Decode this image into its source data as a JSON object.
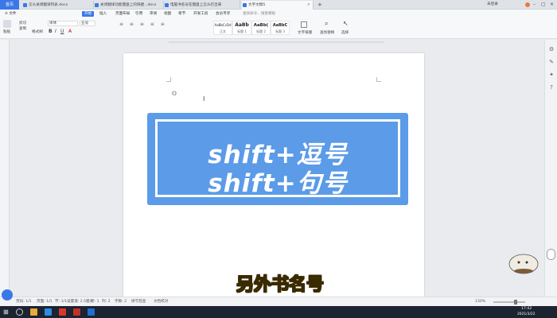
{
  "tabbar": {
    "home": "首页",
    "tabs": [
      {
        "label": "怎么关闭翻译列表.docx"
      },
      {
        "label": "关闭翻译功能键盘上的快捷...docx"
      },
      {
        "label": "电脑书名号在键盘上怎么打出来"
      },
      {
        "label": "文字文稿5"
      }
    ],
    "add": "+",
    "right": {
      "login": "未登录",
      "collab": "协作",
      "share": "分享"
    }
  },
  "menu": {
    "file": "≡ 文件",
    "items": [
      "开始",
      "插入",
      "页面布局",
      "引用",
      "审阅",
      "视图",
      "章节",
      "开发工具",
      "会员专享"
    ],
    "search": "查找命令、搜索模板"
  },
  "ribbon": {
    "paste": "粘贴",
    "cut": "剪切",
    "copy": "复制",
    "format_painter": "格式刷",
    "font": "宋体",
    "font_size": "五号",
    "styles": [
      {
        "preview": "AaBbCcDd",
        "name": "正文"
      },
      {
        "preview": "AaBb",
        "name": "标题 1"
      },
      {
        "preview": "AaBb(",
        "name": "标题 2"
      },
      {
        "preview": "AaBbC",
        "name": "标题 3"
      }
    ],
    "text_layout": "文字排版",
    "find_replace": "查找替换",
    "select": "选择"
  },
  "document": {
    "banner_line1": "shift+逗号",
    "banner_line2": "shift+句号",
    "cursor_text": "《》"
  },
  "subtitle": "另外书名号",
  "status": {
    "page": "页码: 1/1",
    "pages": "页面: 1/1",
    "section": "节: 1/1",
    "settings": "设置值: 2.5厘米",
    "row": "行: 1",
    "col": "列: 2",
    "words": "字数: 2",
    "spell": "拼写检查",
    "doc_check": "文档校对",
    "zoom": "130%"
  },
  "taskbar": {
    "time": "17:42",
    "date": "2021/3/22"
  },
  "colors": {
    "accent": "#3b78e7",
    "banner": "#5b9be8",
    "subtitle_fill": "#ffe14d"
  }
}
